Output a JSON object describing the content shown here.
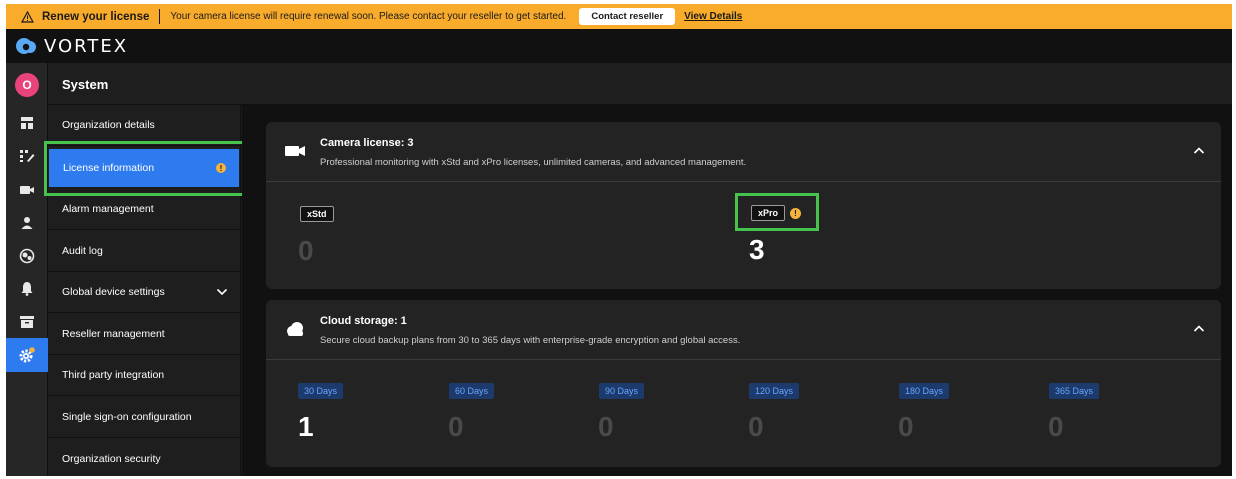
{
  "banner": {
    "title": "Renew your license",
    "message": "Your camera license will require renewal soon. Please contact your reseller to get started.",
    "contact_label": "Contact reseller",
    "details_label": "View Details",
    "icon": "warning-icon"
  },
  "brand": {
    "name": "VORTEX",
    "icon": "vortex-logo-icon"
  },
  "rail": {
    "avatar_initial": "O",
    "items": [
      "dashboard-icon",
      "tasks-icon",
      "camera-icon",
      "user-icon",
      "integrations-icon",
      "bell-icon",
      "archive-icon",
      "settings-icon"
    ]
  },
  "header": {
    "title": "System"
  },
  "subnav": {
    "items": [
      {
        "label": "Organization details"
      },
      {
        "label": "License information",
        "active": true
      },
      {
        "label": "Alarm management"
      },
      {
        "label": "Audit log"
      },
      {
        "label": "Global device settings"
      },
      {
        "label": "Reseller management"
      },
      {
        "label": "Third party integration"
      },
      {
        "label": "Single sign-on configuration"
      },
      {
        "label": "Organization security"
      }
    ]
  },
  "camera_card": {
    "title": "Camera license: 3",
    "description": "Professional monitoring with xStd and xPro licenses, unlimited cameras, and advanced management.",
    "licenses": [
      {
        "tag": "xStd",
        "count": "0"
      },
      {
        "tag": "xPro",
        "count": "3"
      }
    ]
  },
  "cloud_card": {
    "title": "Cloud storage: 1",
    "description": "Secure cloud backup plans from 30 to 365 days with enterprise-grade encryption and global access.",
    "plans": [
      {
        "tag": "30 Days",
        "count": "1"
      },
      {
        "tag": "60 Days",
        "count": "0"
      },
      {
        "tag": "90 Days",
        "count": "0"
      },
      {
        "tag": "120 Days",
        "count": "0"
      },
      {
        "tag": "180 Days",
        "count": "0"
      },
      {
        "tag": "365 Days",
        "count": "0"
      }
    ]
  },
  "colors": {
    "banner": "#f9ab2b",
    "accent": "#2e7bf0",
    "highlight": "#45c34d",
    "info": "#f4b33f"
  }
}
